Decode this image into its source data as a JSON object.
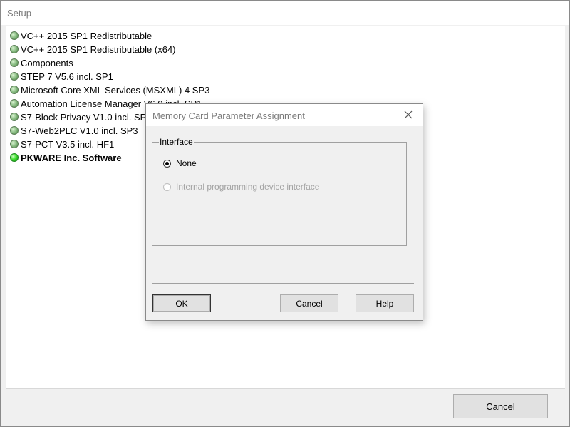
{
  "setup": {
    "title": "Setup",
    "components": [
      {
        "label": "VC++ 2015 SP1 Redistributable",
        "status": "installed"
      },
      {
        "label": "VC++ 2015 SP1 Redistributable (x64)",
        "status": "installed"
      },
      {
        "label": "Components",
        "status": "installed"
      },
      {
        "label": "STEP 7  V5.6 incl. SP1",
        "status": "installed"
      },
      {
        "label": "Microsoft Core XML Services (MSXML) 4 SP3",
        "status": "installed"
      },
      {
        "label": "Automation License Manager V6.0 incl. SP1",
        "status": "installed"
      },
      {
        "label": "S7-Block Privacy V1.0 incl. SP4",
        "status": "installed"
      },
      {
        "label": "S7-Web2PLC V1.0 incl. SP3",
        "status": "installed"
      },
      {
        "label": "S7-PCT V3.5 incl. HF1",
        "status": "installed"
      },
      {
        "label": "PKWARE Inc. Software",
        "status": "in-progress"
      }
    ],
    "cancel_label": "Cancel"
  },
  "dialog": {
    "title": "Memory Card Parameter Assignment",
    "close_icon": "close-icon",
    "interface_group": {
      "legend": "Interface",
      "options": [
        {
          "label": "None",
          "selected": true,
          "enabled": true
        },
        {
          "label": "Internal programming device interface",
          "selected": false,
          "enabled": false
        }
      ]
    },
    "buttons": {
      "ok": "OK",
      "cancel": "Cancel",
      "help": "Help"
    }
  },
  "colors": {
    "window_bg": "#f0f0f0",
    "led_installed": "#8fc089",
    "led_active": "#40e030",
    "disabled_text": "#a3a3a3"
  }
}
